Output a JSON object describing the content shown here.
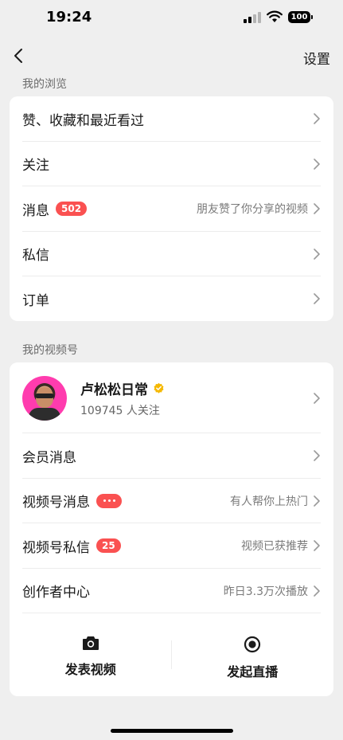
{
  "status": {
    "time": "19:24",
    "battery": "100"
  },
  "nav": {
    "settings_label": "设置"
  },
  "browse": {
    "header": "我的浏览",
    "items": [
      {
        "label": "赞、收藏和最近看过"
      },
      {
        "label": "关注"
      },
      {
        "label": "消息",
        "badge": "502",
        "detail": "朋友赞了你分享的视频"
      },
      {
        "label": "私信"
      },
      {
        "label": "订单"
      }
    ]
  },
  "channels": {
    "header": "我的视频号",
    "profile": {
      "name": "卢松松日常",
      "followers": "109745 人关注"
    },
    "items": [
      {
        "label": "会员消息"
      },
      {
        "label": "视频号消息",
        "badge": "···",
        "detail": "有人帮你上热门"
      },
      {
        "label": "视频号私信",
        "badge": "25",
        "detail": "视频已获推荐"
      },
      {
        "label": "创作者中心",
        "detail": "昨日3.3万次播放"
      }
    ],
    "actions": [
      {
        "label": "发表视频",
        "icon": "camera-icon"
      },
      {
        "label": "发起直播",
        "icon": "live-icon"
      }
    ]
  },
  "colors": {
    "badge_red": "#fa5151",
    "verified_gold": "#f5b800",
    "background": "#efefef"
  }
}
